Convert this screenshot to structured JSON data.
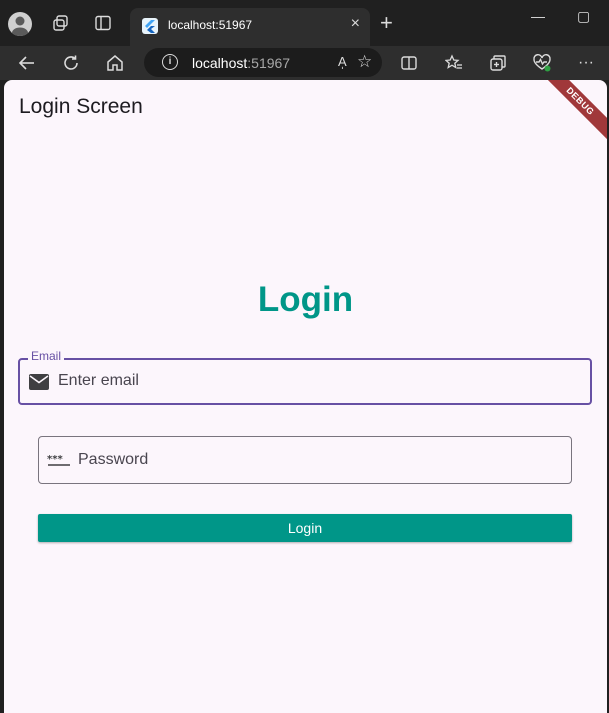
{
  "browser": {
    "tab_title": "localhost:51967",
    "tab_close": "×",
    "new_tab": "+",
    "address_host": "localhost",
    "address_port": ":51967",
    "read_aloud": "A̩",
    "minimize": "—",
    "maximize": "▢",
    "more": "···"
  },
  "app": {
    "appbar_title": "Login Screen",
    "debug_banner": "DEBUG",
    "heading": "Login",
    "email": {
      "label": "Email",
      "placeholder": "Enter email"
    },
    "password": {
      "placeholder": "Password"
    },
    "login_button": "Login"
  },
  "colors": {
    "primary": "#009688",
    "focus_outline": "#6750a4",
    "page_background": "#fcf6fc",
    "debug_banner": "#a0383a"
  }
}
